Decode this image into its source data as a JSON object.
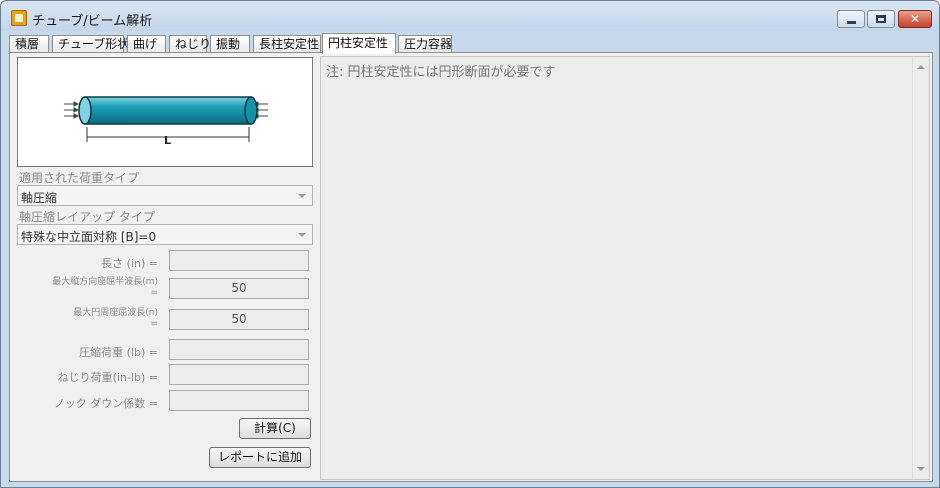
{
  "window": {
    "title": "チューブ/ビーム解析",
    "icon": "app-icon",
    "controls": [
      "minimize-icon",
      "maximize-icon",
      "close-icon"
    ]
  },
  "tabs": [
    {
      "label": "積層",
      "active": false
    },
    {
      "label": "チューブ形状",
      "active": false
    },
    {
      "label": "曲げ",
      "active": false
    },
    {
      "label": "ねじり",
      "active": false
    },
    {
      "label": "振動",
      "active": false
    },
    {
      "label": "長柱安定性",
      "active": false
    },
    {
      "label": "円柱安定性",
      "active": true
    },
    {
      "label": "圧力容器",
      "active": false
    }
  ],
  "diagram": {
    "dimension_label": "L",
    "tube_color": "#1fa0b8",
    "tube_edge_color": "#0b3a44"
  },
  "load_type": {
    "label": "適用された荷重タイプ",
    "value": "軸圧縮"
  },
  "layup_type": {
    "label": "軸圧縮レイアップ タイプ",
    "value": "特殊な中立面対称 [B]=0"
  },
  "fields": {
    "length": {
      "label": "長さ (in) =",
      "value": ""
    },
    "max_long_half_waves": {
      "label_line1": "最大縦方向座屈半波長(m)",
      "label_line2": "=",
      "value": "50"
    },
    "max_circ_waves": {
      "label_line1": "最大円周座屈波長(n)",
      "label_line2": "=",
      "value": "50"
    },
    "compressive_load": {
      "label": "圧縮荷重 (lb) =",
      "value": ""
    },
    "torsion_load": {
      "label": "ねじり荷重(in-lb) =",
      "value": ""
    },
    "knockdown_factor": {
      "label": "ノック ダウン係数 =",
      "value": ""
    }
  },
  "buttons": {
    "calculate": "計算(C)",
    "add_to_report": "レポートに追加"
  },
  "note": "注:  円柱安定性には円形断面が必要です"
}
